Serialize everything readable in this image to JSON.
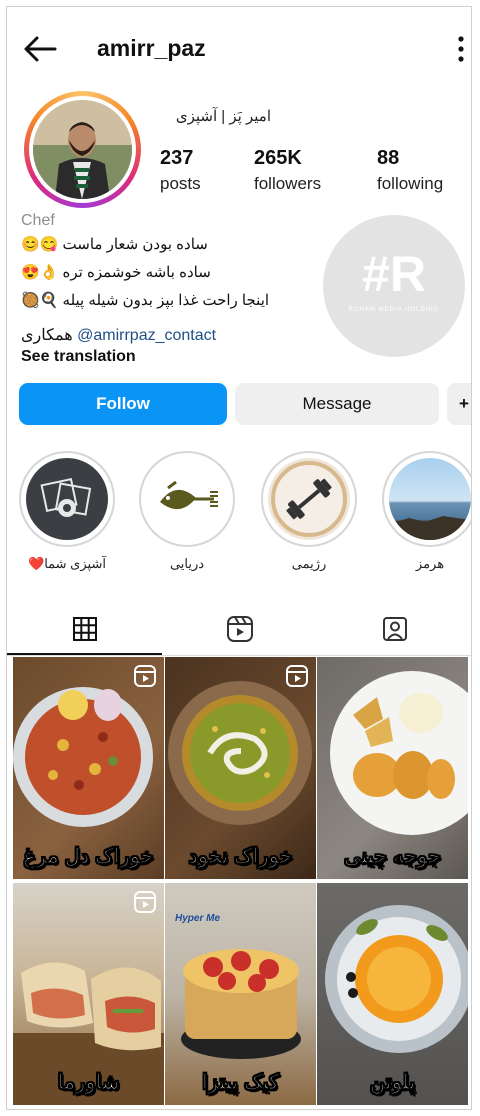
{
  "header": {
    "username": "amirr_paz"
  },
  "profile": {
    "full_name": "امیر پَز | آشپزی",
    "stats": [
      {
        "value": "237",
        "label": "posts"
      },
      {
        "value": "265K",
        "label": "followers"
      },
      {
        "value": "88",
        "label": "following"
      }
    ],
    "category": "Chef",
    "bio": [
      "ساده بودن شعار ماست 😋😊",
      "ساده باشه خوشمزه تره 👌😍",
      "اینجا راحت غذا بپز بدون شیله پیله 🍳🥘"
    ],
    "contact_handle": "@amirrpaz_contact",
    "contact_suffix": "همکاری",
    "see_translation": "See translation"
  },
  "watermark": {
    "text": "#R",
    "subtext": "ROHAM MEDIA HOLDING"
  },
  "buttons": {
    "follow": "Follow",
    "message": "Message",
    "more": "+"
  },
  "highlights": [
    {
      "label": "آشپزی شما❤️"
    },
    {
      "label": "دریایی"
    },
    {
      "label": "رژیمی"
    },
    {
      "label": "هرمز"
    }
  ],
  "posts": [
    {
      "caption": "خوراک دل مرغ"
    },
    {
      "caption": "خوراک نخود"
    },
    {
      "caption": "جوجه چینی"
    },
    {
      "caption": "شاورما"
    },
    {
      "caption": "کیک پیتزا",
      "badge": "Hyper Me"
    },
    {
      "caption": "پلوتن"
    }
  ],
  "colors": {
    "follow_blue": "#0a95f6",
    "link_blue": "#1f4f85"
  }
}
